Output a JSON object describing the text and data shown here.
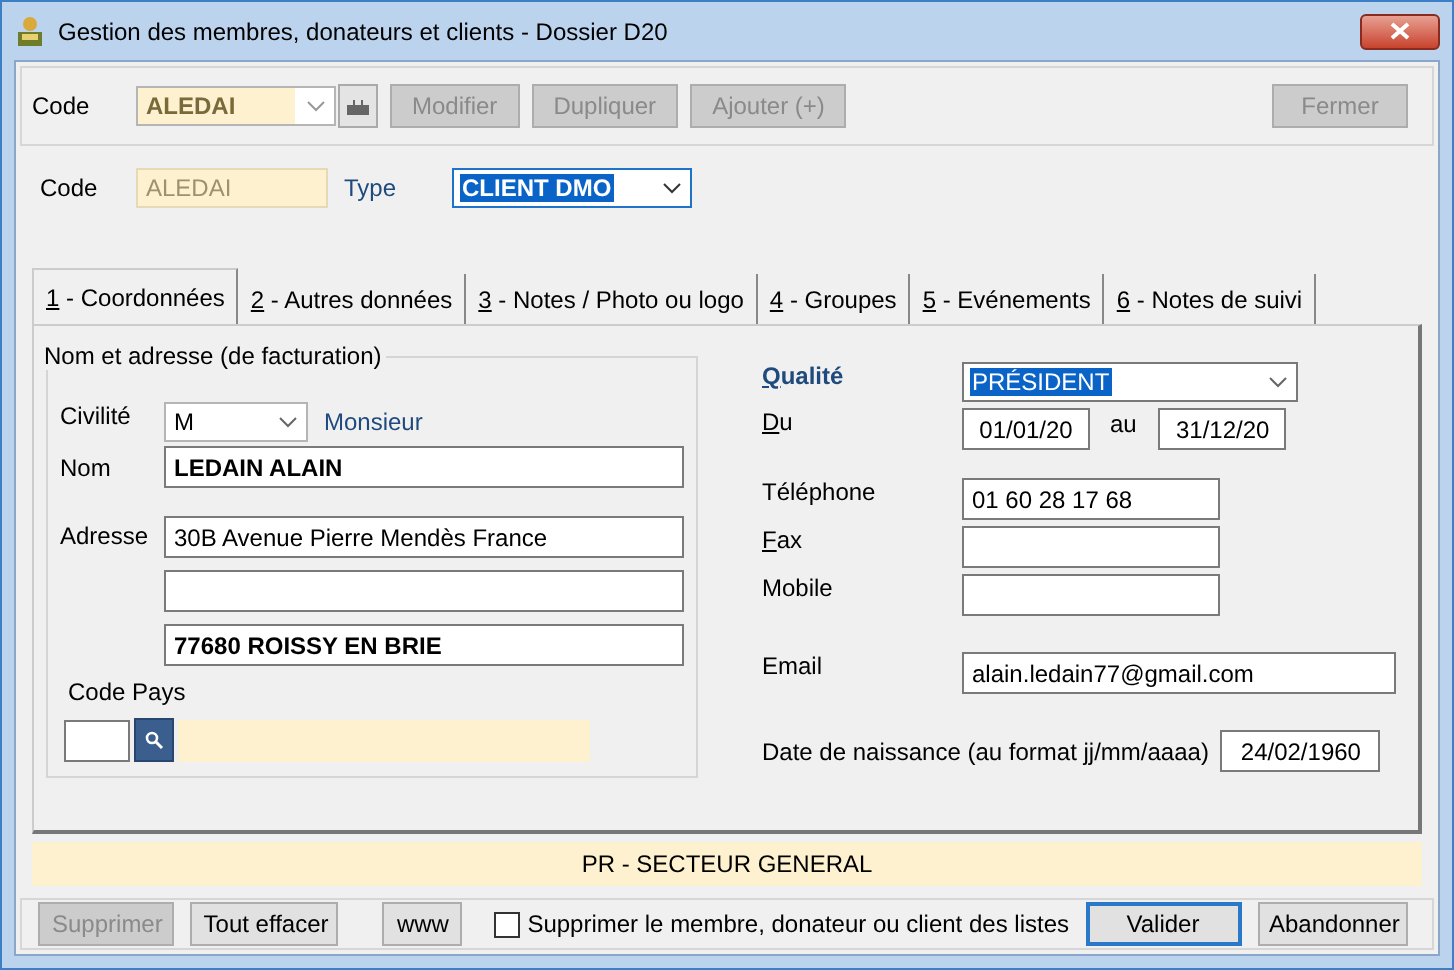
{
  "window": {
    "title": "Gestion des membres, donateurs et clients - Dossier D20"
  },
  "toolbar": {
    "code_label": "Code",
    "code_value": "ALEDAI",
    "buttons": [
      {
        "label": "Modifier",
        "disabled": true
      },
      {
        "label": "Dupliquer",
        "disabled": true
      },
      {
        "label": "Ajouter (+)",
        "disabled": true
      }
    ],
    "close_button": {
      "label": "Fermer",
      "disabled": true
    }
  },
  "header": {
    "code_label": "Code",
    "code_value": "ALEDAI",
    "type_label": "Type",
    "type_value": "CLIENT DMO"
  },
  "tabs": [
    {
      "label": "1 - Coordonnées",
      "selected": true
    },
    {
      "label": "2 - Autres données",
      "selected": false
    },
    {
      "label": "3 - Notes / Photo ou logo",
      "selected": false
    },
    {
      "label": "4 - Groupes",
      "selected": false
    },
    {
      "label": "5 - Evénements",
      "selected": false
    },
    {
      "label": "6 - Notes de suivi",
      "selected": false
    }
  ],
  "address_group": {
    "title": "Nom et adresse (de facturation)",
    "civility_label": "Civilité",
    "civility_value": "M",
    "civility_text": "Monsieur",
    "name_label": "Nom",
    "name_value": "LEDAIN ALAIN",
    "address_label": "Adresse",
    "address_lines": [
      {
        "kind": "text",
        "value": "30B Avenue Pierre Mendès France",
        "bold": false
      },
      {
        "kind": "blank"
      },
      {
        "kind": "text",
        "value": "77680 ROISSY EN BRIE",
        "bold": true
      }
    ],
    "country_label": "Code Pays"
  },
  "details": {
    "quality_label": {
      "text": "Qualité",
      "mnemonic": true
    },
    "quality_value": "PRÉSIDENT",
    "from_label": {
      "text": "Du",
      "mnemonic": true
    },
    "from_value": "01/01/20",
    "to_label": "au",
    "to_value": "31/12/20",
    "contacts": [
      {
        "label": "Téléphone",
        "mnemonic": false,
        "value": "01 60 28 17 68"
      },
      {
        "label": "Fax",
        "mnemonic": true
      },
      {
        "label": "Mobile",
        "mnemonic": false
      }
    ],
    "email_label": "Email",
    "email_value": "alain.ledain77@gmail.com",
    "birth_label": "Date de naissance (au format jj/mm/aaaa)",
    "birth_value": "24/02/1960"
  },
  "sector": "PR - SECTEUR GENERAL",
  "footer": {
    "buttons": [
      {
        "label": "Supprimer",
        "disabled": true
      },
      {
        "label": "Tout effacer",
        "disabled": false
      },
      {
        "label": "www",
        "disabled": false
      }
    ],
    "remove_checkbox": {
      "label": "Supprimer le membre, donateur ou client des listes",
      "checked": false
    },
    "actions": [
      {
        "label": "Valider",
        "default": true
      },
      {
        "label": "Abandonner",
        "default": false
      }
    ]
  }
}
